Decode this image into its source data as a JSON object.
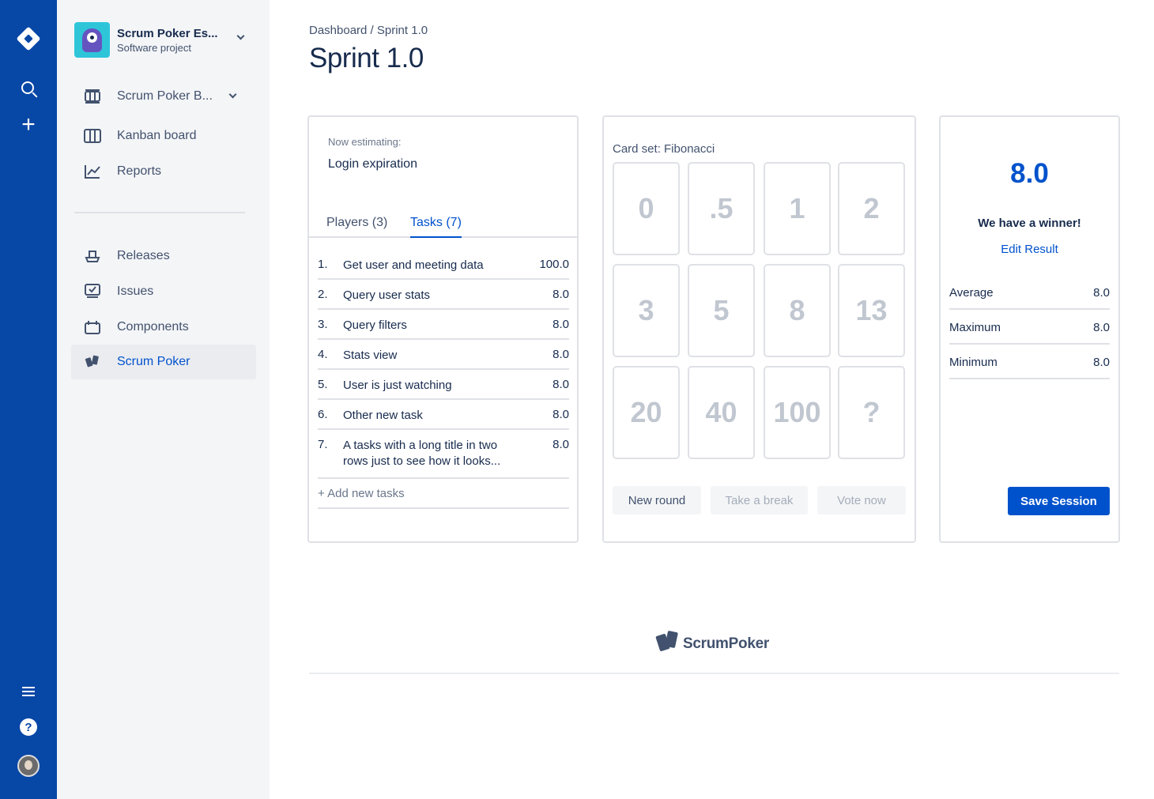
{
  "global_nav": {
    "icons": [
      "jira-logo-icon",
      "search-icon",
      "plus-icon",
      "menu-icon",
      "help-icon",
      "user-avatar"
    ]
  },
  "project": {
    "name": "Scrum Poker Es...",
    "type": "Software project"
  },
  "sidebar": {
    "items": [
      {
        "label": "Scrum Poker B...",
        "icon": "board-icon"
      },
      {
        "label": "Kanban board",
        "icon": "kanban-icon"
      },
      {
        "label": "Reports",
        "icon": "reports-icon"
      },
      {
        "label": "Releases",
        "icon": "releases-icon"
      },
      {
        "label": "Issues",
        "icon": "issues-icon"
      },
      {
        "label": "Components",
        "icon": "components-icon"
      },
      {
        "label": "Scrum Poker",
        "icon": "scrum-poker-icon",
        "active": true
      }
    ]
  },
  "header": {
    "breadcrumb": "Dashboard / Sprint 1.0",
    "title": "Sprint 1.0"
  },
  "estimation": {
    "now_label": "Now estimating:",
    "now_value": "Login expiration",
    "tabs": [
      {
        "label": "Players (3)"
      },
      {
        "label": "Tasks (7)",
        "active": true
      }
    ],
    "tasks": [
      {
        "num": "1.",
        "name": "Get user and meeting data",
        "points": "100.0"
      },
      {
        "num": "2.",
        "name": "Query user stats",
        "points": "8.0"
      },
      {
        "num": "3.",
        "name": "Query filters",
        "points": "8.0"
      },
      {
        "num": "4.",
        "name": "Stats view",
        "points": "8.0"
      },
      {
        "num": "5.",
        "name": "User is just watching",
        "points": "8.0"
      },
      {
        "num": "6.",
        "name": "Other new task",
        "points": "8.0"
      },
      {
        "num": "7.",
        "name": "A tasks with a long title in two rows just to see how it looks...",
        "points": "8.0"
      }
    ],
    "add_task": "+ Add new tasks"
  },
  "cards": {
    "set_label": "Card set: Fibonacci",
    "values": [
      "0",
      ".5",
      "1",
      "2",
      "3",
      "5",
      "8",
      "13",
      "20",
      "40",
      "100",
      "?"
    ],
    "buttons": {
      "new_round": "New round",
      "take_break": "Take a break",
      "vote_now": "Vote now"
    }
  },
  "result": {
    "value": "8.0",
    "winner": "We have a winner!",
    "edit": "Edit Result",
    "stats": [
      {
        "label": "Average",
        "value": "8.0"
      },
      {
        "label": "Maximum",
        "value": "8.0"
      },
      {
        "label": "Minimum",
        "value": "8.0"
      }
    ],
    "save": "Save Session"
  },
  "footer": {
    "brand": "ScrumPoker"
  },
  "colors": {
    "global_nav": "#0747a6",
    "accent": "#0052cc",
    "sidebar_bg": "#f4f5f7"
  }
}
